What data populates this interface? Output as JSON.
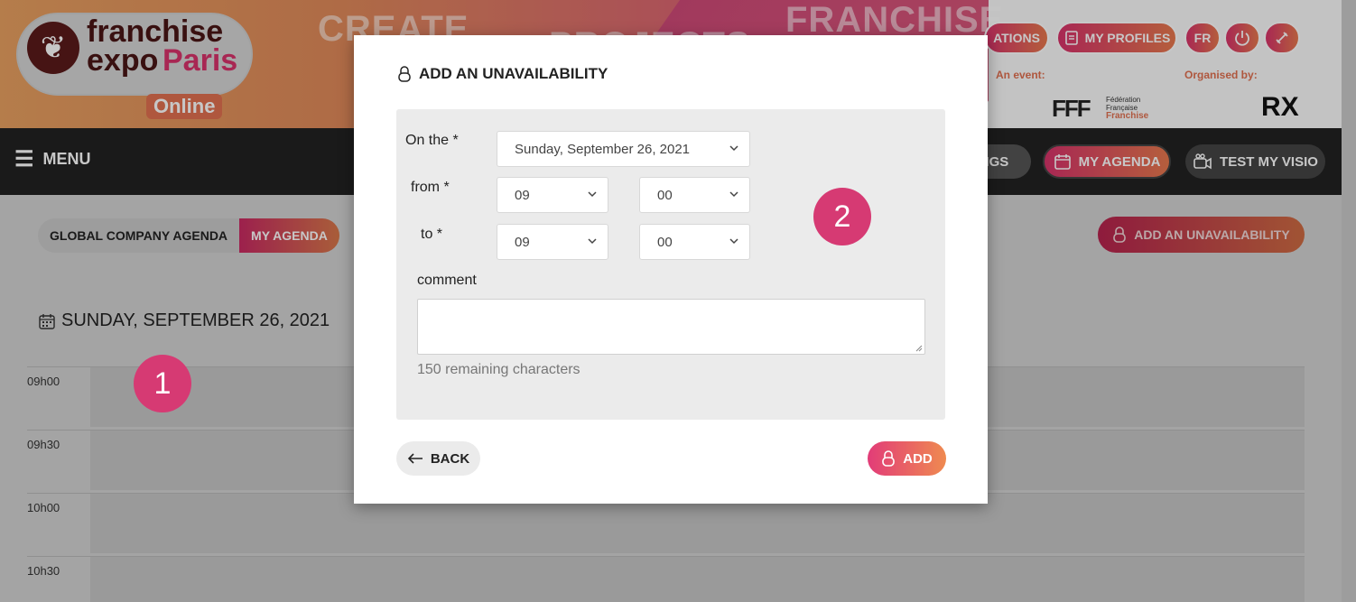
{
  "header": {
    "logo": {
      "line1": "franchise",
      "line2a": "expo",
      "line2b": "Paris",
      "badge": "Online"
    },
    "banner_words": [
      "CREATE",
      "PROJECTS",
      "FRANCHISE"
    ],
    "buttons": {
      "applications": "ATIONS",
      "my_profiles": "MY PROFILES",
      "lang": "FR"
    },
    "an_event": "An event:",
    "organised_by": "Organised by:",
    "fff_text": {
      "l1": "Fédération",
      "l2": "Française",
      "l3": "Franchise"
    },
    "rx": "RX"
  },
  "nav": {
    "menu": "MENU",
    "meetings_partial": "NGS",
    "my_agenda": "MY AGENDA",
    "test_visio": "TEST MY VISIO"
  },
  "agenda": {
    "toggle": {
      "global": "GLOBAL COMPANY AGENDA",
      "mine": "MY AGENDA"
    },
    "add_unavailability": "ADD AN UNAVAILABILITY",
    "day_title": "SUNDAY, SEPTEMBER 26, 2021",
    "slots": [
      "09h00",
      "09h30",
      "10h00",
      "10h30"
    ]
  },
  "annotations": {
    "badge1": "1",
    "badge2": "2"
  },
  "modal": {
    "title": "ADD AN UNAVAILABILITY",
    "on_the_label": "On the *",
    "on_the_value": "Sunday, September 26, 2021",
    "from_label": "from *",
    "from_hour": "09",
    "from_minute": "00",
    "to_label": "to *",
    "to_hour": "09",
    "to_minute": "00",
    "comment_label": "comment",
    "comment_value": "",
    "remaining": "150 remaining characters",
    "back": "BACK",
    "add": "ADD"
  },
  "colors": {
    "accent_pink": "#d8336b",
    "accent_orange": "#e8794e",
    "navbar": "#222222"
  }
}
